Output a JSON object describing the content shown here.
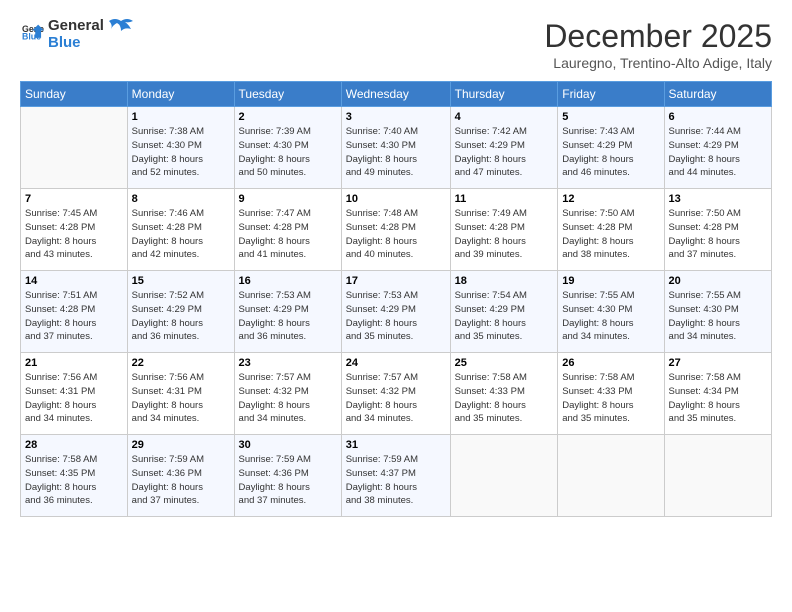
{
  "logo": {
    "line1": "General",
    "line2": "Blue"
  },
  "title": "December 2025",
  "subtitle": "Lauregno, Trentino-Alto Adige, Italy",
  "weekdays": [
    "Sunday",
    "Monday",
    "Tuesday",
    "Wednesday",
    "Thursday",
    "Friday",
    "Saturday"
  ],
  "weeks": [
    [
      {
        "day": "",
        "info": ""
      },
      {
        "day": "1",
        "info": "Sunrise: 7:38 AM\nSunset: 4:30 PM\nDaylight: 8 hours\nand 52 minutes."
      },
      {
        "day": "2",
        "info": "Sunrise: 7:39 AM\nSunset: 4:30 PM\nDaylight: 8 hours\nand 50 minutes."
      },
      {
        "day": "3",
        "info": "Sunrise: 7:40 AM\nSunset: 4:30 PM\nDaylight: 8 hours\nand 49 minutes."
      },
      {
        "day": "4",
        "info": "Sunrise: 7:42 AM\nSunset: 4:29 PM\nDaylight: 8 hours\nand 47 minutes."
      },
      {
        "day": "5",
        "info": "Sunrise: 7:43 AM\nSunset: 4:29 PM\nDaylight: 8 hours\nand 46 minutes."
      },
      {
        "day": "6",
        "info": "Sunrise: 7:44 AM\nSunset: 4:29 PM\nDaylight: 8 hours\nand 44 minutes."
      }
    ],
    [
      {
        "day": "7",
        "info": "Sunrise: 7:45 AM\nSunset: 4:28 PM\nDaylight: 8 hours\nand 43 minutes."
      },
      {
        "day": "8",
        "info": "Sunrise: 7:46 AM\nSunset: 4:28 PM\nDaylight: 8 hours\nand 42 minutes."
      },
      {
        "day": "9",
        "info": "Sunrise: 7:47 AM\nSunset: 4:28 PM\nDaylight: 8 hours\nand 41 minutes."
      },
      {
        "day": "10",
        "info": "Sunrise: 7:48 AM\nSunset: 4:28 PM\nDaylight: 8 hours\nand 40 minutes."
      },
      {
        "day": "11",
        "info": "Sunrise: 7:49 AM\nSunset: 4:28 PM\nDaylight: 8 hours\nand 39 minutes."
      },
      {
        "day": "12",
        "info": "Sunrise: 7:50 AM\nSunset: 4:28 PM\nDaylight: 8 hours\nand 38 minutes."
      },
      {
        "day": "13",
        "info": "Sunrise: 7:50 AM\nSunset: 4:28 PM\nDaylight: 8 hours\nand 37 minutes."
      }
    ],
    [
      {
        "day": "14",
        "info": "Sunrise: 7:51 AM\nSunset: 4:28 PM\nDaylight: 8 hours\nand 37 minutes."
      },
      {
        "day": "15",
        "info": "Sunrise: 7:52 AM\nSunset: 4:29 PM\nDaylight: 8 hours\nand 36 minutes."
      },
      {
        "day": "16",
        "info": "Sunrise: 7:53 AM\nSunset: 4:29 PM\nDaylight: 8 hours\nand 36 minutes."
      },
      {
        "day": "17",
        "info": "Sunrise: 7:53 AM\nSunset: 4:29 PM\nDaylight: 8 hours\nand 35 minutes."
      },
      {
        "day": "18",
        "info": "Sunrise: 7:54 AM\nSunset: 4:29 PM\nDaylight: 8 hours\nand 35 minutes."
      },
      {
        "day": "19",
        "info": "Sunrise: 7:55 AM\nSunset: 4:30 PM\nDaylight: 8 hours\nand 34 minutes."
      },
      {
        "day": "20",
        "info": "Sunrise: 7:55 AM\nSunset: 4:30 PM\nDaylight: 8 hours\nand 34 minutes."
      }
    ],
    [
      {
        "day": "21",
        "info": "Sunrise: 7:56 AM\nSunset: 4:31 PM\nDaylight: 8 hours\nand 34 minutes."
      },
      {
        "day": "22",
        "info": "Sunrise: 7:56 AM\nSunset: 4:31 PM\nDaylight: 8 hours\nand 34 minutes."
      },
      {
        "day": "23",
        "info": "Sunrise: 7:57 AM\nSunset: 4:32 PM\nDaylight: 8 hours\nand 34 minutes."
      },
      {
        "day": "24",
        "info": "Sunrise: 7:57 AM\nSunset: 4:32 PM\nDaylight: 8 hours\nand 34 minutes."
      },
      {
        "day": "25",
        "info": "Sunrise: 7:58 AM\nSunset: 4:33 PM\nDaylight: 8 hours\nand 35 minutes."
      },
      {
        "day": "26",
        "info": "Sunrise: 7:58 AM\nSunset: 4:33 PM\nDaylight: 8 hours\nand 35 minutes."
      },
      {
        "day": "27",
        "info": "Sunrise: 7:58 AM\nSunset: 4:34 PM\nDaylight: 8 hours\nand 35 minutes."
      }
    ],
    [
      {
        "day": "28",
        "info": "Sunrise: 7:58 AM\nSunset: 4:35 PM\nDaylight: 8 hours\nand 36 minutes."
      },
      {
        "day": "29",
        "info": "Sunrise: 7:59 AM\nSunset: 4:36 PM\nDaylight: 8 hours\nand 37 minutes."
      },
      {
        "day": "30",
        "info": "Sunrise: 7:59 AM\nSunset: 4:36 PM\nDaylight: 8 hours\nand 37 minutes."
      },
      {
        "day": "31",
        "info": "Sunrise: 7:59 AM\nSunset: 4:37 PM\nDaylight: 8 hours\nand 38 minutes."
      },
      {
        "day": "",
        "info": ""
      },
      {
        "day": "",
        "info": ""
      },
      {
        "day": "",
        "info": ""
      }
    ]
  ]
}
